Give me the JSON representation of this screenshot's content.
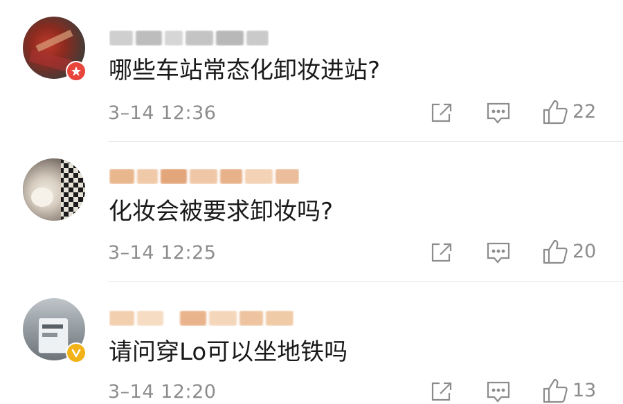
{
  "comments": [
    {
      "text": "哪些车站常态化卸妆进站?",
      "timestamp": "3–14 12:36",
      "likes": "22",
      "avatar_badge": "red-badge-icon"
    },
    {
      "text": "化妆会被要求卸妆吗?",
      "timestamp": "3–14 12:25",
      "likes": "20",
      "avatar_badge": null
    },
    {
      "text": "请问穿Lo可以坐地铁吗",
      "timestamp": "3–14 12:20",
      "likes": "13",
      "avatar_badge": "gold-v-badge-icon"
    }
  ],
  "icons": {
    "share": "share-icon",
    "comment": "comment-icon",
    "like": "thumbs-up-icon"
  },
  "colors": {
    "text": "#1a1a1a",
    "meta": "#8c8c8c",
    "divider": "#e9e9e9",
    "red_badge": "#e8453c",
    "gold_badge": "#f2b318"
  }
}
